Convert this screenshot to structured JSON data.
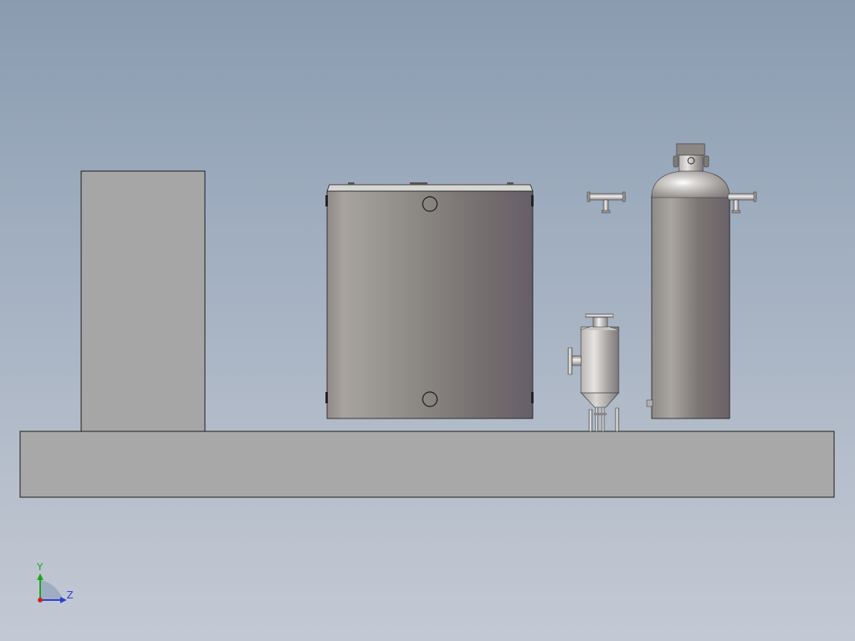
{
  "viewport": {
    "background_top": "#8a9bb0",
    "background_bottom": "#c3c9d4"
  },
  "model": {
    "objects": [
      "base-plate",
      "control-cabinet",
      "large-tank",
      "filter-vessel",
      "pressure-vessel",
      "tee-pipe"
    ],
    "colors": {
      "base": "#a8a8a8",
      "cabinet": "#a6a6a6",
      "steel_light": "#c9c7c4",
      "steel_dark": "#6e6870",
      "outline": "#1a1a1a"
    }
  },
  "triad": {
    "y_label": "Y",
    "z_label": "Z",
    "y_color": "#1aa51a",
    "z_color": "#2a3fd0",
    "origin_color": "#d02020"
  }
}
